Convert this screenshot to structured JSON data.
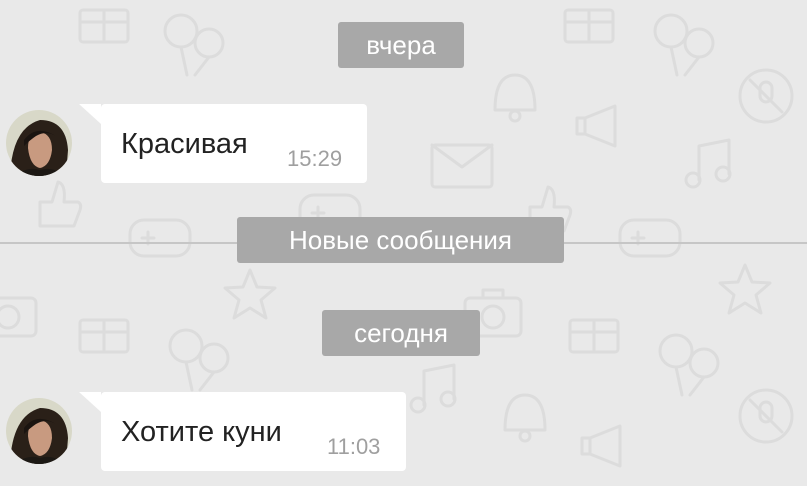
{
  "chat": {
    "date_yesterday": "вчера",
    "new_messages_divider": "Новые сообщения",
    "date_today": "сегодня",
    "messages": [
      {
        "text": "Красивая",
        "time": "15:29"
      },
      {
        "text": "Хотите куни",
        "time": "11:03"
      }
    ]
  },
  "icons": [
    "gift-icon",
    "balloons-icon",
    "bell-icon",
    "megaphone-icon",
    "envelope-icon",
    "music-note-icon",
    "thumbs-up-icon",
    "gamepad-icon",
    "star-icon",
    "camera-icon",
    "no-mic-icon",
    "avatar-photo"
  ],
  "colors": {
    "background": "#e9e9e9",
    "pattern": "#dcdcdc",
    "pill": "#a8a8a8",
    "bubble": "#ffffff",
    "message_text": "#222222",
    "time_text": "#9f9f9f"
  }
}
